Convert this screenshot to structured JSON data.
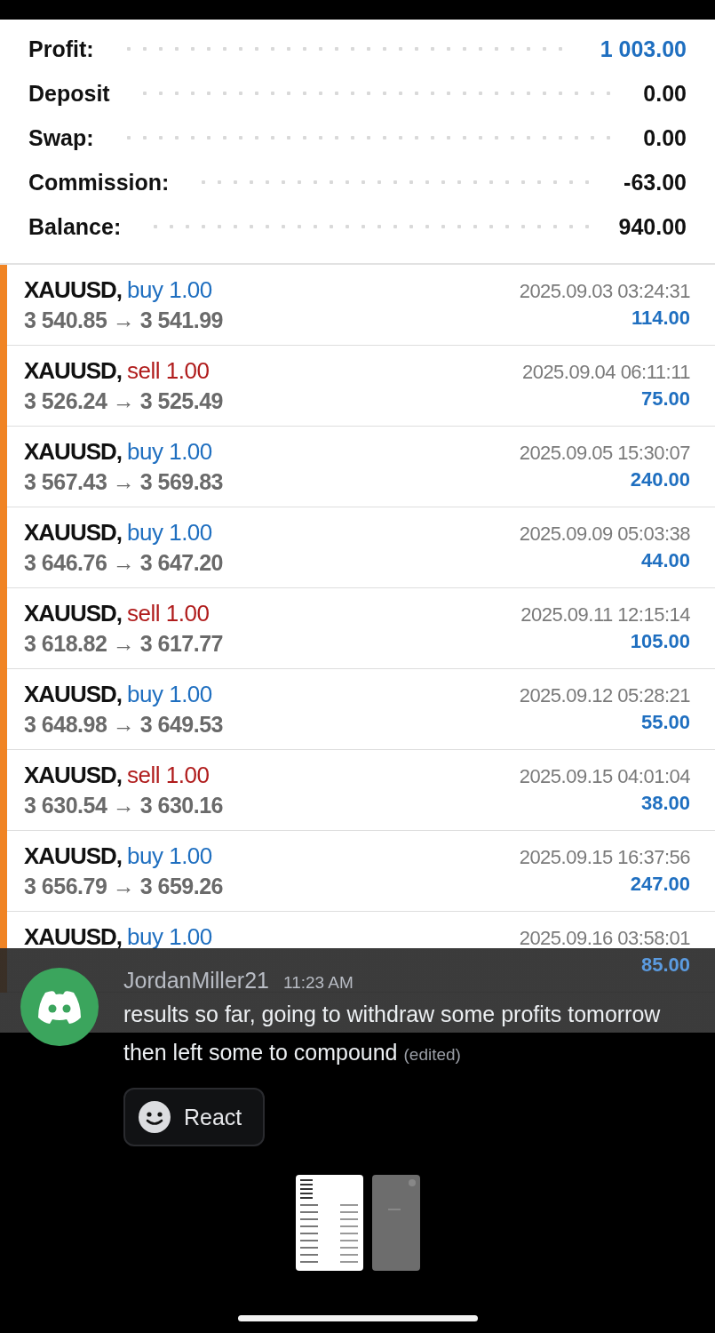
{
  "summary": [
    {
      "label": "Profit:",
      "value": "1 003.00",
      "highlight": true
    },
    {
      "label": "Deposit",
      "value": "0.00",
      "highlight": false
    },
    {
      "label": "Swap:",
      "value": "0.00",
      "highlight": false
    },
    {
      "label": "Commission:",
      "value": "-63.00",
      "highlight": false
    },
    {
      "label": "Balance:",
      "value": "940.00",
      "highlight": false
    }
  ],
  "deals": [
    {
      "symbol": "XAUUSD,",
      "side": "buy",
      "volume": "1.00",
      "prices": "3 540.85 → 3 541.99",
      "time": "2025.09.03 03:24:31",
      "profit": "114.00"
    },
    {
      "symbol": "XAUUSD,",
      "side": "sell",
      "volume": "1.00",
      "prices": "3 526.24 → 3 525.49",
      "time": "2025.09.04 06:11:11",
      "profit": "75.00"
    },
    {
      "symbol": "XAUUSD,",
      "side": "buy",
      "volume": "1.00",
      "prices": "3 567.43 → 3 569.83",
      "time": "2025.09.05 15:30:07",
      "profit": "240.00"
    },
    {
      "symbol": "XAUUSD,",
      "side": "buy",
      "volume": "1.00",
      "prices": "3 646.76 → 3 647.20",
      "time": "2025.09.09 05:03:38",
      "profit": "44.00"
    },
    {
      "symbol": "XAUUSD,",
      "side": "sell",
      "volume": "1.00",
      "prices": "3 618.82 → 3 617.77",
      "time": "2025.09.11 12:15:14",
      "profit": "105.00"
    },
    {
      "symbol": "XAUUSD,",
      "side": "buy",
      "volume": "1.00",
      "prices": "3 648.98 → 3 649.53",
      "time": "2025.09.12 05:28:21",
      "profit": "55.00"
    },
    {
      "symbol": "XAUUSD,",
      "side": "sell",
      "volume": "1.00",
      "prices": "3 630.54 → 3 630.16",
      "time": "2025.09.15 04:01:04",
      "profit": "38.00"
    },
    {
      "symbol": "XAUUSD,",
      "side": "buy",
      "volume": "1.00",
      "prices": "3 656.79 → 3 659.26",
      "time": "2025.09.15 16:37:56",
      "profit": "247.00"
    },
    {
      "symbol": "XAUUSD,",
      "side": "buy",
      "volume": "1.00",
      "time": "2025.09.16 03:58:01",
      "profit": "85.00"
    }
  ],
  "message": {
    "author": "JordanMiller21",
    "time": "11:23 AM",
    "text": "results so far, going to withdraw some profits tomorrow then left some to compound",
    "edited": "(edited)",
    "react_button": "React"
  }
}
